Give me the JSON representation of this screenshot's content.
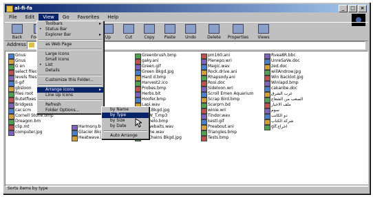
{
  "window": {
    "title": "al-fi-fa"
  },
  "title_buttons": [
    "_",
    "□",
    "×"
  ],
  "menubar": [
    "File",
    "Edit",
    "View",
    "Go",
    "Favorites",
    "Help"
  ],
  "toolbar": [
    "Back",
    "Forward",
    "Up",
    "Cut",
    "Copy",
    "Paste",
    "Undo",
    "Delete",
    "Properties",
    "Views"
  ],
  "address": {
    "label": "Address",
    "value": ""
  },
  "status": "Sorts items by type",
  "view_menu": [
    {
      "label": "Toolbars",
      "arrow": true
    },
    {
      "label": "Status Bar",
      "check": true
    },
    {
      "label": "Explorer Bar",
      "arrow": true
    },
    {
      "sep": true
    },
    {
      "label": "as Web Page"
    },
    {
      "sep": true
    },
    {
      "label": "Large Icons"
    },
    {
      "label": "Small Icons"
    },
    {
      "label": "List",
      "check": true
    },
    {
      "label": "Details"
    },
    {
      "sep": true
    },
    {
      "label": "Customize this Folder..."
    },
    {
      "sep": true
    },
    {
      "label": "Arrange Icons",
      "arrow": true,
      "hl": true
    },
    {
      "label": "Line Up Icons"
    },
    {
      "sep": true
    },
    {
      "label": "Refresh"
    },
    {
      "label": "Folder Options..."
    }
  ],
  "arrange_menu": [
    {
      "label": "by Name"
    },
    {
      "label": "by Type",
      "hl": true
    },
    {
      "label": "by Size"
    },
    {
      "label": "by Date"
    },
    {
      "sep": true
    },
    {
      "label": "Auto Arrange"
    }
  ],
  "columns": [
    [
      "Gnus",
      "Gnus",
      "G en",
      "select files",
      "levels files",
      "ll-gif",
      "gbsloon",
      "files root",
      "Butetfixes",
      "Bridgess",
      "car.scm",
      "Cornell Stone.bmp",
      "Dreagon.bm",
      "clip.mt",
      "computer.jpg"
    ],
    [
      "",
      "",
      "",
      "",
      "",
      "",
      "",
      "",
      "",
      "",
      "",
      "",
      "",
      "Harmony.bmp",
      "Glacier Bkgd.jpg",
      "Heatwave.bm"
    ],
    [
      "Greenbrush.bmp",
      "gaky.ani",
      "Green.gif",
      "Green Bkgd.jpg",
      "Hard d.bmp",
      "Harvest2.ico",
      "Probes.bmp",
      "Herbs.bit",
      "Hoofer.bmp",
      "Lapi.wav",
      "mnt.Bkgd.jpg",
      "Pa_W_T.mp3",
      "Nemelo.bmp",
      "Pinwebaits.wav",
      "Phone.wav",
      "Pb Chains Bkgd.jpg"
    ],
    [
      "pm160.ani",
      "Plenepo.wri",
      "Magic.wav",
      "Rock.drive.ani",
      "Rhapsody.ani",
      "Rosi.doc",
      "Sideloon.wri",
      "Scroll Emen Aquarium",
      "Scrap Bird.bmp",
      "Scarprn.bd",
      "winie.wri",
      "Tindor.wav",
      "kestl.gif",
      "Preabout.ani",
      "Triangles.bmp",
      "Tests.bmp"
    ],
    [
      "Rvea8R.bbc",
      "UnreSaVe.doc",
      "zed.doc",
      "willAndrow.jpg",
      "Win Backlot.jpg",
      "Winlapd.bmp",
      "cakanbe.doc",
      "غرب الشرق",
      "الصعب من الشعاع",
      "ملف الاخبار",
      "سوم",
      "دو الكاتب",
      "شركة الكتاب",
      "gif.اخراج"
    ]
  ]
}
